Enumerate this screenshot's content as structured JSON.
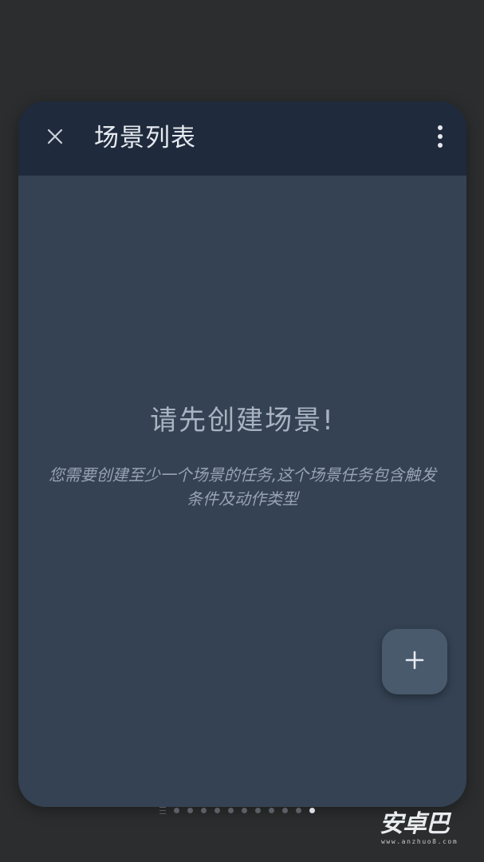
{
  "appbar": {
    "title": "场景列表",
    "close_icon": "close-icon",
    "more_icon": "more-vertical-icon"
  },
  "empty_state": {
    "title": "请先创建场景!",
    "description": "您需要创建至少一个场景的任务,这个场景任务包含触发条件及动作类型"
  },
  "fab": {
    "icon": "plus-icon"
  },
  "pager": {
    "count": 11,
    "active_index": 10
  },
  "watermark": {
    "brand": "安卓巴",
    "url": "www.anzhuo8.com"
  },
  "colors": {
    "background": "#2b2d2e",
    "appbar": "#1f2a3c",
    "card": "#344253",
    "fab": "#4a5a6d",
    "text_primary": "#e6eaf0",
    "text_muted": "#98a3b2"
  }
}
